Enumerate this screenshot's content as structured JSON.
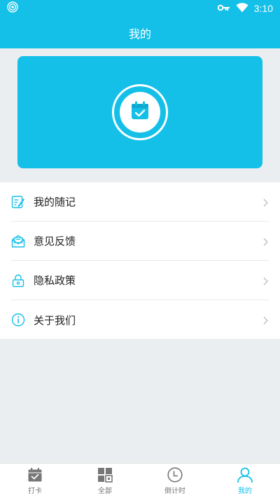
{
  "status_bar": {
    "time": "3:10",
    "icons": [
      "podcast-icon",
      "key-icon",
      "wifi-icon"
    ]
  },
  "header": {
    "title": "我的"
  },
  "hero": {
    "icon": "calendar-check-icon"
  },
  "menu": {
    "items": [
      {
        "label": "我的随记",
        "icon": "note-edit-icon"
      },
      {
        "label": "意见反馈",
        "icon": "mail-open-icon"
      },
      {
        "label": "隐私政策",
        "icon": "lock-icon"
      },
      {
        "label": "关于我们",
        "icon": "info-icon"
      }
    ]
  },
  "tabs": [
    {
      "label": "打卡",
      "icon": "calendar-check-icon",
      "active": false
    },
    {
      "label": "全部",
      "icon": "grid-icon",
      "active": false
    },
    {
      "label": "倒计时",
      "icon": "clock-icon",
      "active": false
    },
    {
      "label": "我的",
      "icon": "user-icon",
      "active": true
    }
  ],
  "colors": {
    "primary": "#14c0e8",
    "background": "#ebeef0",
    "inactive": "#777777"
  }
}
